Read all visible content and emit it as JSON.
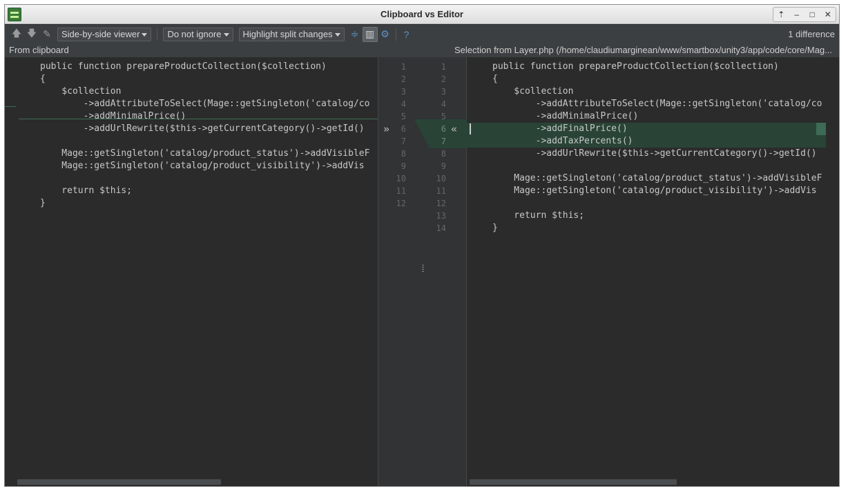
{
  "window": {
    "title": "Clipboard vs Editor",
    "controls": [
      "⇡",
      "–",
      "□",
      "✕"
    ]
  },
  "toolbar": {
    "prev_icon": "arrow-up-icon",
    "next_icon": "arrow-down-icon",
    "edit_icon": "edit-source-icon",
    "viewer_mode": "Side-by-side viewer",
    "ignore_mode": "Do not ignore",
    "highlight_mode": "Highlight split changes",
    "difference_count": "1 difference"
  },
  "headers": {
    "left": "From clipboard",
    "right": "Selection from Layer.php (/home/claudiumarginean/www/smartbox/unity3/app/code/core/Mag..."
  },
  "left_editor": {
    "lines": [
      "public function prepareProductCollection($collection)",
      "{",
      "    $collection",
      "        ->addAttributeToSelect(Mage::getSingleton('catalog/co",
      "        ->addMinimalPrice()",
      "        ->addUrlRewrite($this->getCurrentCategory()->getId()",
      "",
      "    Mage::getSingleton('catalog/product_status')->addVisibleF",
      "    Mage::getSingleton('catalog/product_visibility')->addVis",
      "",
      "    return $this;",
      "}"
    ]
  },
  "right_editor": {
    "lines": [
      "public function prepareProductCollection($collection)",
      "{",
      "    $collection",
      "        ->addAttributeToSelect(Mage::getSingleton('catalog/co",
      "        ->addMinimalPrice()",
      "        ->addFinalPrice()",
      "        ->addTaxPercents()",
      "        ->addUrlRewrite($this->getCurrentCategory()->getId()",
      "",
      "    Mage::getSingleton('catalog/product_status')->addVisibleF",
      "    Mage::getSingleton('catalog/product_visibility')->addVis",
      "",
      "    return $this;",
      "}"
    ]
  },
  "gutter": {
    "left_numbers": [
      "1",
      "2",
      "3",
      "4",
      "5",
      "6",
      "7",
      "8",
      "9",
      "10",
      "11",
      "12"
    ],
    "right_numbers": [
      "1",
      "2",
      "3",
      "4",
      "5",
      "6",
      "7",
      "8",
      "9",
      "10",
      "11",
      "12",
      "13",
      "14"
    ],
    "apply_left_arrow": "»",
    "apply_right_arrow": "«"
  },
  "colors": {
    "background": "#2b2b2b",
    "inserted_block": "#294436",
    "toolbar": "#3c3f41"
  }
}
